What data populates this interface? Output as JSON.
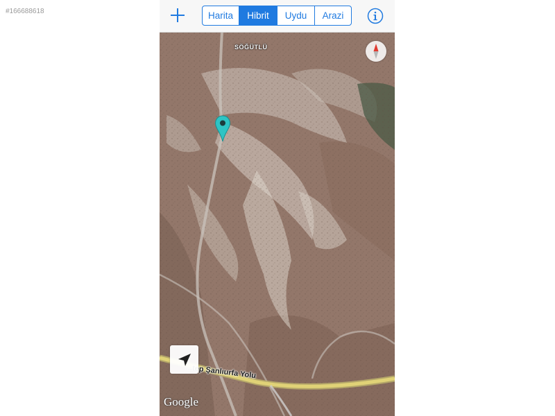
{
  "page": {
    "listing_id": "#166688618"
  },
  "toolbar": {
    "add_icon": "plus-icon",
    "map_types": [
      {
        "label": "Harita",
        "active": false
      },
      {
        "label": "Hibrit",
        "active": true
      },
      {
        "label": "Uydu",
        "active": false
      },
      {
        "label": "Arazi",
        "active": false
      }
    ],
    "info_icon": "info-icon"
  },
  "map": {
    "place_label": "SÖĞÜTLÜ",
    "road_label": "...tep Şanlıurfa Yolu",
    "attribution": "Google",
    "compass_icon": "compass-icon",
    "pin_icon": "location-pin-icon",
    "locate_icon": "location-arrow-icon"
  },
  "colors": {
    "accent": "#1f7ae0",
    "pin": "#2ec4c4",
    "terrain_base": "#93776a",
    "road_major": "#e0d277"
  }
}
